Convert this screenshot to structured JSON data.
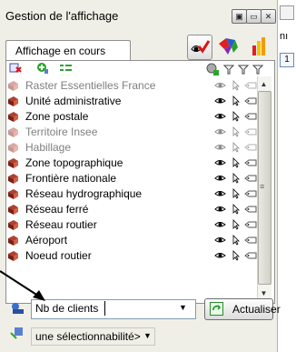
{
  "window": {
    "title": "Gestion de l'affichage"
  },
  "right_strip": {
    "text1": "nı",
    "text2": "1"
  },
  "tab": {
    "label": "Affichage en cours"
  },
  "icons": {
    "add": "add-layer-icon",
    "remove": "remove-layer-icon",
    "group": "group-icon",
    "settings": "settings-icon",
    "filter": "filter-icon"
  },
  "layers": [
    {
      "label": "Raster Essentielles France",
      "color": "#7f7f7f"
    },
    {
      "label": "Unité administrative",
      "color": "#000000"
    },
    {
      "label": "Zone postale",
      "color": "#000000"
    },
    {
      "label": "Territoire Insee",
      "color": "#7f7f7f"
    },
    {
      "label": "Habillage",
      "color": "#7f7f7f"
    },
    {
      "label": "Zone topographique",
      "color": "#000000"
    },
    {
      "label": "Frontière nationale",
      "color": "#000000"
    },
    {
      "label": "Réseau hydrographique",
      "color": "#000000"
    },
    {
      "label": "Réseau ferré",
      "color": "#000000"
    },
    {
      "label": "Réseau routier",
      "color": "#000000"
    },
    {
      "label": "Aéroport",
      "color": "#000000"
    },
    {
      "label": "Noeud routier",
      "color": "#000000"
    }
  ],
  "combo_main": {
    "value": "Nb de clients"
  },
  "refresh_button": {
    "label": "Actualiser"
  },
  "combo_select": {
    "value": "une sélectionnabilité>"
  }
}
